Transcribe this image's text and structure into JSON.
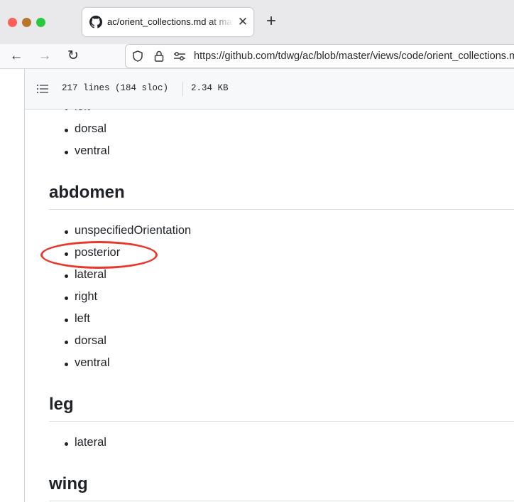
{
  "browser": {
    "tab": {
      "title": "ac/orient_collections.md at master",
      "close_label": "✕"
    },
    "new_tab_label": "+",
    "nav": {
      "back_label": "←",
      "forward_label": "→",
      "reload_label": "↻"
    },
    "url": "https://github.com/tdwg/ac/blob/master/views/code/orient_collections.md"
  },
  "file_info": {
    "lines": "217 lines (184 sloc)",
    "size": "2.34 KB"
  },
  "markdown": {
    "top_partial_item": "left",
    "top_items": [
      "dorsal",
      "ventral"
    ],
    "sections": [
      {
        "heading": "abdomen",
        "items": [
          "unspecifiedOrientation",
          "posterior",
          "lateral",
          "right",
          "left",
          "dorsal",
          "ventral"
        ]
      },
      {
        "heading": "leg",
        "items": [
          "lateral"
        ]
      },
      {
        "heading": "wing",
        "items": []
      }
    ]
  },
  "annotation": {
    "circled_item": "posterior",
    "color": "#e8382b"
  },
  "colors": {
    "tabbar_bg": "#e9e9ec",
    "text": "#1f2328",
    "border": "#d0d7de"
  }
}
